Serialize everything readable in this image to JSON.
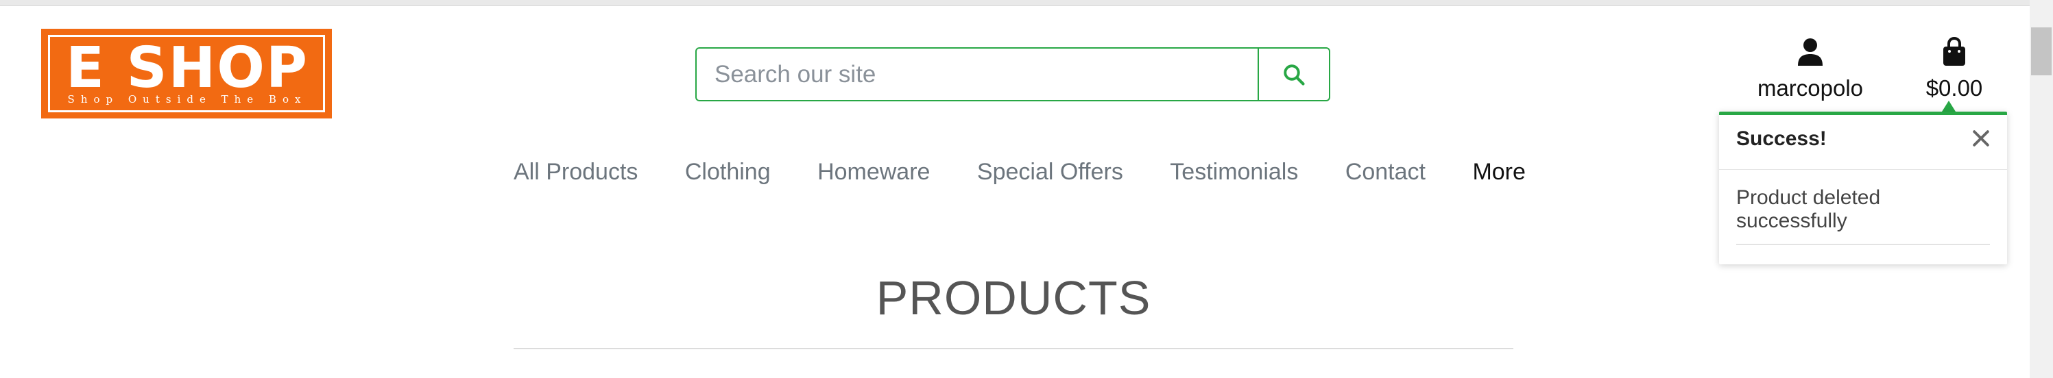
{
  "logo": {
    "title": "E SHOP",
    "tagline": "Shop Outside The Box",
    "brand_color": "#f26a12"
  },
  "search": {
    "placeholder": "Search our site",
    "icon": "search-icon",
    "accent": "#28a745"
  },
  "account": {
    "username": "marcopolo",
    "icon": "user-icon"
  },
  "bag": {
    "total": "$0.00",
    "icon": "shopping-bag-icon"
  },
  "nav": {
    "items": [
      {
        "label": "All Products"
      },
      {
        "label": "Clothing"
      },
      {
        "label": "Homeware"
      },
      {
        "label": "Special Offers"
      },
      {
        "label": "Testimonials"
      },
      {
        "label": "Contact"
      },
      {
        "label": "More"
      }
    ]
  },
  "main": {
    "title": "PRODUCTS"
  },
  "toast": {
    "title": "Success!",
    "message": "Product deleted successfully",
    "close_icon": "close-icon",
    "accent": "#28a745"
  }
}
